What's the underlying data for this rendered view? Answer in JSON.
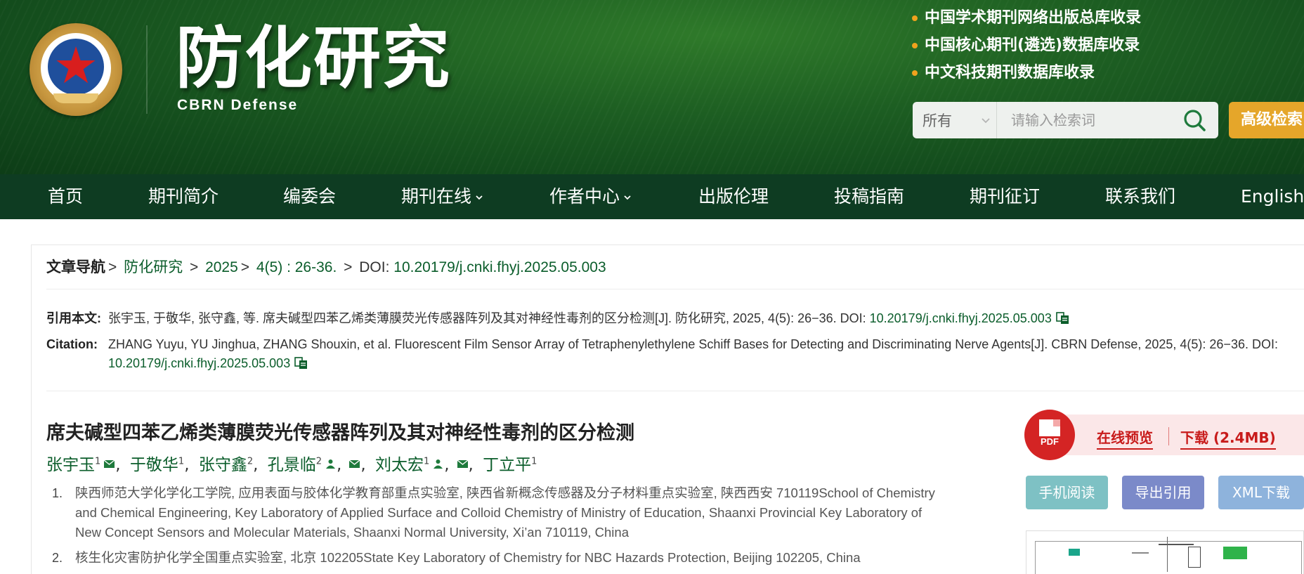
{
  "header": {
    "title": "防化研究",
    "subtitle": "CBRN Defense",
    "indexing": [
      "中国学术期刊网络出版总库收录",
      "中国核心期刊(遴选)数据库收录",
      "中文科技期刊数据库收录"
    ],
    "search": {
      "scope_selected": "所有",
      "placeholder": "请输入检索词",
      "query": ""
    },
    "advanced_search_label": "高级检索"
  },
  "nav": {
    "items": [
      {
        "label": "首页"
      },
      {
        "label": "期刊简介"
      },
      {
        "label": "编委会"
      },
      {
        "label": "期刊在线",
        "has_dropdown": true
      },
      {
        "label": "作者中心",
        "has_dropdown": true
      },
      {
        "label": "出版伦理"
      },
      {
        "label": "投稿指南"
      },
      {
        "label": "期刊征订"
      },
      {
        "label": "联系我们"
      },
      {
        "label": "English"
      }
    ]
  },
  "breadcrumb": {
    "label": "文章导航",
    "journal": "防化研究",
    "year": "2025",
    "issue": "4(5) : 26-36.",
    "doi_label": "DOI:",
    "doi": "10.20179/j.cnki.fhyj.2025.05.003"
  },
  "citation_cn": {
    "label": "引用本文:",
    "text": "张宇玉, 于敬华, 张守鑫, 等. 席夫碱型四苯乙烯类薄膜荧光传感器阵列及其对神经性毒剂的区分检测[J]. 防化研究, 2025, 4(5): 26−36. DOI: ",
    "doi": "10.20179/j.cnki.fhyj.2025.05.003"
  },
  "citation_en": {
    "label": "Citation:",
    "text": "ZHANG Yuyu, YU Jinghua, ZHANG Shouxin, et al. Fluorescent Film Sensor Array of Tetraphenylethylene Schiff Bases for Detecting and Discriminating Nerve Agents[J]. CBRN Defense, 2025, 4(5): 26−36. DOI: ",
    "doi": "10.20179/j.cnki.fhyj.2025.05.003"
  },
  "article": {
    "title": "席夫碱型四苯乙烯类薄膜荧光传感器阵列及其对神经性毒剂的区分检测",
    "authors": [
      {
        "name": "张宇玉",
        "aff": "1"
      },
      {
        "name": "于敬华",
        "aff": "1"
      },
      {
        "name": "张守鑫",
        "aff": "2"
      },
      {
        "name": "孔景临",
        "aff": "2"
      },
      {
        "name": "刘太宏",
        "aff": "1"
      },
      {
        "name": "丁立平",
        "aff": "1"
      }
    ],
    "affiliations": [
      {
        "num": "1.",
        "text": "陕西师范大学化学化工学院, 应用表面与胶体化学教育部重点实验室, 陕西省新概念传感器及分子材料重点实验室, 陕西西安 710119School of Chemistry and Chemical Engineering, Key Laboratory of Applied Surface and Colloid Chemistry of Ministry of Education, Shaanxi Provincial Key Laboratory of New Concept Sensors and Molecular Materials, Shaanxi Normal University, Xi’an 710119, China"
      },
      {
        "num": "2.",
        "text": "核生化灾害防护化学全国重点实验室, 北京 102205State Key Laboratory of Chemistry for NBC Hazards Protection, Beijing 102205, China"
      }
    ]
  },
  "sidebar": {
    "pdf_badge": "PDF",
    "preview_label": "在线预览",
    "download_label": "下载 (2.4MB)",
    "mobile_read_label": "手机阅读",
    "export_citation_label": "导出引用",
    "xml_download_label": "XML下载"
  },
  "colors": {
    "header_green": "#1d5e22",
    "nav_green": "#0e3c22",
    "link_green": "#0b5d2b",
    "accent_orange": "#e5a62a",
    "pdf_red": "#d42424",
    "btn_teal": "#7ec1c4",
    "btn_indigo": "#7b8ac9",
    "btn_lightblue": "#8eb3dc"
  }
}
